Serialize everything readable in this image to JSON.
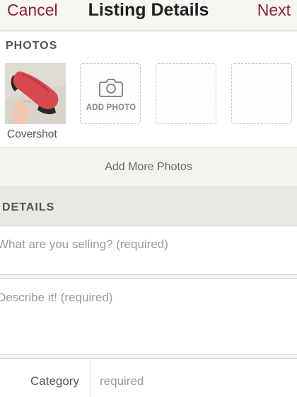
{
  "nav": {
    "cancel_label": "Cancel",
    "title": "Listing Details",
    "next_label": "Next"
  },
  "photos": {
    "section_label": "PHOTOS",
    "cover_label": "Covershot",
    "add_photo_label": "ADD PHOTO",
    "add_more_label": "Add More Photos"
  },
  "details": {
    "section_label": "DETAILS",
    "title_placeholder": "What are you selling? (required)",
    "description_placeholder": "Describe it! (required)",
    "category": {
      "label": "Category",
      "value": "required"
    }
  },
  "colors": {
    "accent": "#8c2333",
    "shoe": "#d8484c"
  },
  "icons": {
    "add_photo": "camera-icon"
  }
}
